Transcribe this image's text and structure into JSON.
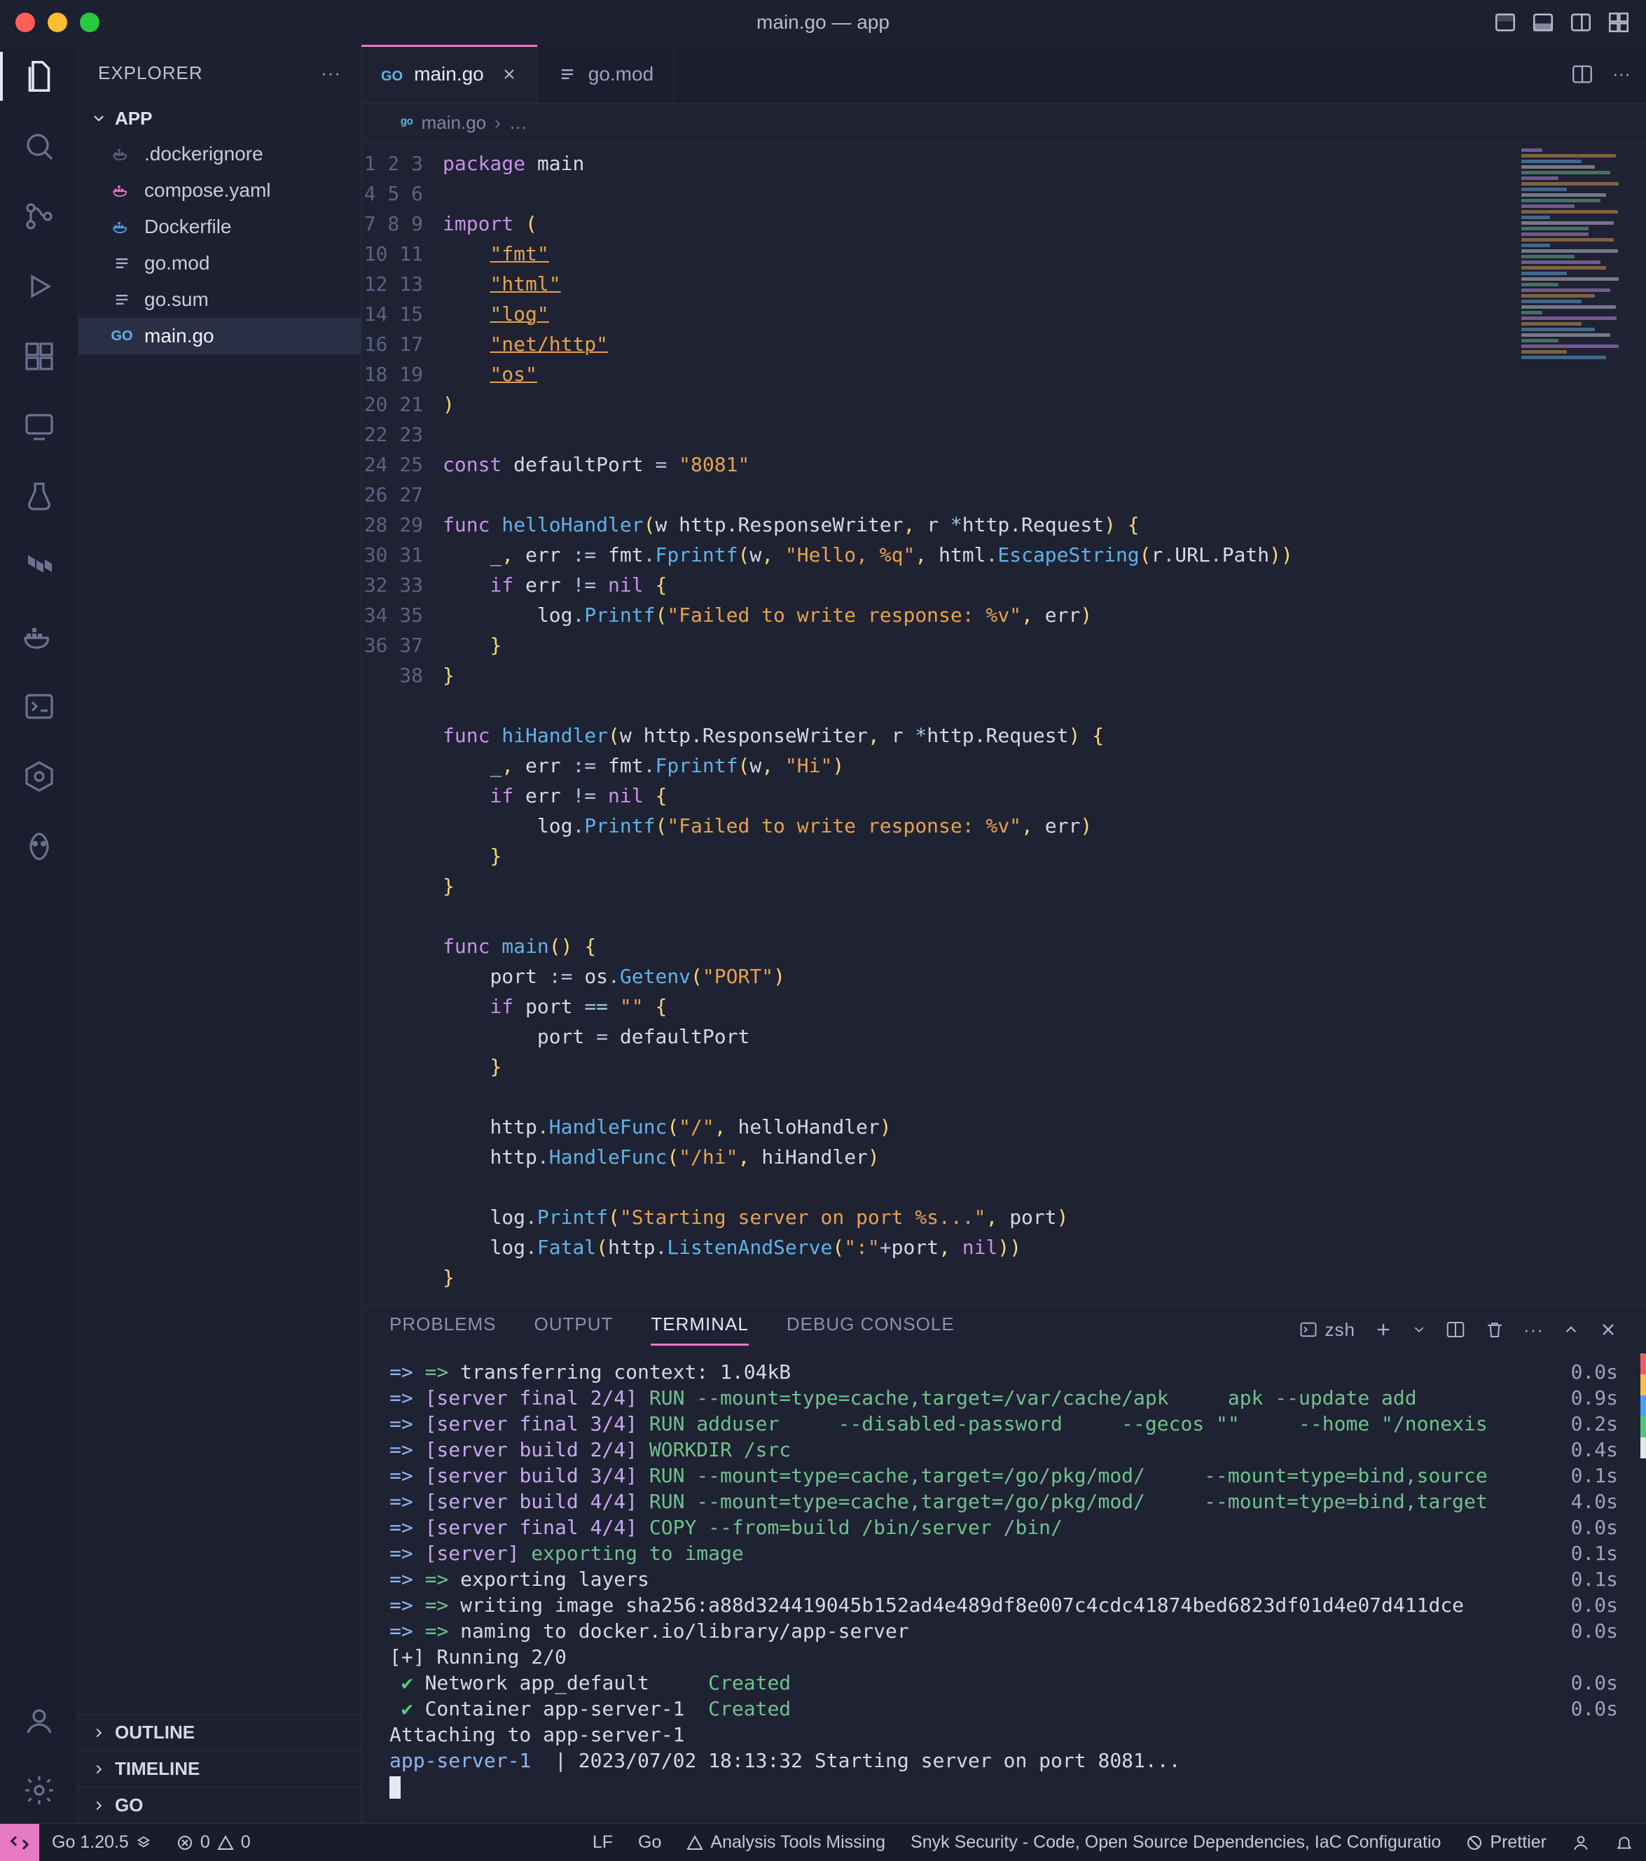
{
  "window": {
    "title": "main.go — app"
  },
  "explorer": {
    "title": "EXPLORER",
    "root": "APP",
    "files": [
      {
        "name": ".dockerignore",
        "icon": "docker-dim"
      },
      {
        "name": "compose.yaml",
        "icon": "docker-pink"
      },
      {
        "name": "Dockerfile",
        "icon": "docker"
      },
      {
        "name": "go.mod",
        "icon": "lines"
      },
      {
        "name": "go.sum",
        "icon": "lines"
      },
      {
        "name": "main.go",
        "icon": "go",
        "selected": true
      }
    ],
    "sections": [
      "OUTLINE",
      "TIMELINE",
      "GO"
    ]
  },
  "tabs": [
    {
      "label": "main.go",
      "icon": "go",
      "active": true,
      "closeable": true
    },
    {
      "label": "go.mod",
      "icon": "lines",
      "active": false,
      "closeable": false
    }
  ],
  "breadcrumb": {
    "file": "main.go",
    "trail": "…"
  },
  "code": {
    "lines": 38,
    "tokens": [
      [
        [
          "kw",
          "package"
        ],
        [
          "sp",
          " "
        ],
        [
          "id",
          "main"
        ]
      ],
      [],
      [
        [
          "kw",
          "import"
        ],
        [
          "sp",
          " "
        ],
        [
          "pun",
          "("
        ]
      ],
      [
        [
          "sp",
          "    "
        ],
        [
          "str-u",
          "\"fmt\""
        ]
      ],
      [
        [
          "sp",
          "    "
        ],
        [
          "str-u",
          "\"html\""
        ]
      ],
      [
        [
          "sp",
          "    "
        ],
        [
          "str-u",
          "\"log\""
        ]
      ],
      [
        [
          "sp",
          "    "
        ],
        [
          "str-u",
          "\"net/http\""
        ]
      ],
      [
        [
          "sp",
          "    "
        ],
        [
          "str-u",
          "\"os\""
        ]
      ],
      [
        [
          "pun",
          ")"
        ]
      ],
      [],
      [
        [
          "kw",
          "const"
        ],
        [
          "sp",
          " "
        ],
        [
          "id",
          "defaultPort"
        ],
        [
          "sp",
          " "
        ],
        [
          "op",
          "="
        ],
        [
          "sp",
          " "
        ],
        [
          "str",
          "\"8081\""
        ]
      ],
      [],
      [
        [
          "kw",
          "func"
        ],
        [
          "sp",
          " "
        ],
        [
          "name",
          "helloHandler"
        ],
        [
          "pun",
          "("
        ],
        [
          "id",
          "w"
        ],
        [
          "sp",
          " "
        ],
        [
          "typ",
          "http.ResponseWriter"
        ],
        [
          "pun",
          ","
        ],
        [
          "sp",
          " "
        ],
        [
          "id",
          "r"
        ],
        [
          "sp",
          " "
        ],
        [
          "op",
          "*"
        ],
        [
          "typ",
          "http.Request"
        ],
        [
          "pun",
          ")"
        ],
        [
          "sp",
          " "
        ],
        [
          "pun",
          "{"
        ]
      ],
      [
        [
          "sp",
          "    "
        ],
        [
          "id",
          "_"
        ],
        [
          "pun",
          ","
        ],
        [
          "sp",
          " "
        ],
        [
          "id",
          "err"
        ],
        [
          "sp",
          " "
        ],
        [
          "op",
          ":="
        ],
        [
          "sp",
          " "
        ],
        [
          "id",
          "fmt"
        ],
        [
          "op",
          "."
        ],
        [
          "call",
          "Fprintf"
        ],
        [
          "pun",
          "("
        ],
        [
          "id",
          "w"
        ],
        [
          "pun",
          ","
        ],
        [
          "sp",
          " "
        ],
        [
          "str",
          "\"Hello, %q\""
        ],
        [
          "pun",
          ","
        ],
        [
          "sp",
          " "
        ],
        [
          "id",
          "html"
        ],
        [
          "op",
          "."
        ],
        [
          "call",
          "EscapeString"
        ],
        [
          "pun",
          "("
        ],
        [
          "id",
          "r"
        ],
        [
          "op",
          "."
        ],
        [
          "id",
          "URL"
        ],
        [
          "op",
          "."
        ],
        [
          "id",
          "Path"
        ],
        [
          "pun",
          ")"
        ],
        [
          "pun",
          ")"
        ]
      ],
      [
        [
          "sp",
          "    "
        ],
        [
          "kw",
          "if"
        ],
        [
          "sp",
          " "
        ],
        [
          "id",
          "err"
        ],
        [
          "sp",
          " "
        ],
        [
          "op",
          "!="
        ],
        [
          "sp",
          " "
        ],
        [
          "bool",
          "nil"
        ],
        [
          "sp",
          " "
        ],
        [
          "pun",
          "{"
        ]
      ],
      [
        [
          "sp",
          "        "
        ],
        [
          "id",
          "log"
        ],
        [
          "op",
          "."
        ],
        [
          "call",
          "Printf"
        ],
        [
          "pun",
          "("
        ],
        [
          "str",
          "\"Failed to write response: %v\""
        ],
        [
          "pun",
          ","
        ],
        [
          "sp",
          " "
        ],
        [
          "id",
          "err"
        ],
        [
          "pun",
          ")"
        ]
      ],
      [
        [
          "sp",
          "    "
        ],
        [
          "pun",
          "}"
        ]
      ],
      [
        [
          "pun",
          "}"
        ]
      ],
      [],
      [
        [
          "kw",
          "func"
        ],
        [
          "sp",
          " "
        ],
        [
          "name",
          "hiHandler"
        ],
        [
          "pun",
          "("
        ],
        [
          "id",
          "w"
        ],
        [
          "sp",
          " "
        ],
        [
          "typ",
          "http.ResponseWriter"
        ],
        [
          "pun",
          ","
        ],
        [
          "sp",
          " "
        ],
        [
          "id",
          "r"
        ],
        [
          "sp",
          " "
        ],
        [
          "op",
          "*"
        ],
        [
          "typ",
          "http.Request"
        ],
        [
          "pun",
          ")"
        ],
        [
          "sp",
          " "
        ],
        [
          "pun",
          "{"
        ]
      ],
      [
        [
          "sp",
          "    "
        ],
        [
          "id",
          "_"
        ],
        [
          "pun",
          ","
        ],
        [
          "sp",
          " "
        ],
        [
          "id",
          "err"
        ],
        [
          "sp",
          " "
        ],
        [
          "op",
          ":="
        ],
        [
          "sp",
          " "
        ],
        [
          "id",
          "fmt"
        ],
        [
          "op",
          "."
        ],
        [
          "call",
          "Fprintf"
        ],
        [
          "pun",
          "("
        ],
        [
          "id",
          "w"
        ],
        [
          "pun",
          ","
        ],
        [
          "sp",
          " "
        ],
        [
          "str",
          "\"Hi\""
        ],
        [
          "pun",
          ")"
        ]
      ],
      [
        [
          "sp",
          "    "
        ],
        [
          "kw",
          "if"
        ],
        [
          "sp",
          " "
        ],
        [
          "id",
          "err"
        ],
        [
          "sp",
          " "
        ],
        [
          "op",
          "!="
        ],
        [
          "sp",
          " "
        ],
        [
          "bool",
          "nil"
        ],
        [
          "sp",
          " "
        ],
        [
          "pun",
          "{"
        ]
      ],
      [
        [
          "sp",
          "        "
        ],
        [
          "id",
          "log"
        ],
        [
          "op",
          "."
        ],
        [
          "call",
          "Printf"
        ],
        [
          "pun",
          "("
        ],
        [
          "str",
          "\"Failed to write response: %v\""
        ],
        [
          "pun",
          ","
        ],
        [
          "sp",
          " "
        ],
        [
          "id",
          "err"
        ],
        [
          "pun",
          ")"
        ]
      ],
      [
        [
          "sp",
          "    "
        ],
        [
          "pun",
          "}"
        ]
      ],
      [
        [
          "pun",
          "}"
        ]
      ],
      [],
      [
        [
          "kw",
          "func"
        ],
        [
          "sp",
          " "
        ],
        [
          "name",
          "main"
        ],
        [
          "pun",
          "("
        ],
        [
          "pun",
          ")"
        ],
        [
          "sp",
          " "
        ],
        [
          "pun",
          "{"
        ]
      ],
      [
        [
          "sp",
          "    "
        ],
        [
          "id",
          "port"
        ],
        [
          "sp",
          " "
        ],
        [
          "op",
          ":="
        ],
        [
          "sp",
          " "
        ],
        [
          "id",
          "os"
        ],
        [
          "op",
          "."
        ],
        [
          "call",
          "Getenv"
        ],
        [
          "pun",
          "("
        ],
        [
          "str",
          "\"PORT\""
        ],
        [
          "pun",
          ")"
        ]
      ],
      [
        [
          "sp",
          "    "
        ],
        [
          "kw",
          "if"
        ],
        [
          "sp",
          " "
        ],
        [
          "id",
          "port"
        ],
        [
          "sp",
          " "
        ],
        [
          "op",
          "=="
        ],
        [
          "sp",
          " "
        ],
        [
          "str",
          "\"\""
        ],
        [
          "sp",
          " "
        ],
        [
          "pun",
          "{"
        ]
      ],
      [
        [
          "sp",
          "        "
        ],
        [
          "id",
          "port"
        ],
        [
          "sp",
          " "
        ],
        [
          "op",
          "="
        ],
        [
          "sp",
          " "
        ],
        [
          "id",
          "defaultPort"
        ]
      ],
      [
        [
          "sp",
          "    "
        ],
        [
          "pun",
          "}"
        ]
      ],
      [],
      [
        [
          "sp",
          "    "
        ],
        [
          "id",
          "http"
        ],
        [
          "op",
          "."
        ],
        [
          "call",
          "HandleFunc"
        ],
        [
          "pun",
          "("
        ],
        [
          "str",
          "\"/\""
        ],
        [
          "pun",
          ","
        ],
        [
          "sp",
          " "
        ],
        [
          "id",
          "helloHandler"
        ],
        [
          "pun",
          ")"
        ]
      ],
      [
        [
          "sp",
          "    "
        ],
        [
          "id",
          "http"
        ],
        [
          "op",
          "."
        ],
        [
          "call",
          "HandleFunc"
        ],
        [
          "pun",
          "("
        ],
        [
          "str",
          "\"/hi\""
        ],
        [
          "pun",
          ","
        ],
        [
          "sp",
          " "
        ],
        [
          "id",
          "hiHandler"
        ],
        [
          "pun",
          ")"
        ]
      ],
      [],
      [
        [
          "sp",
          "    "
        ],
        [
          "id",
          "log"
        ],
        [
          "op",
          "."
        ],
        [
          "call",
          "Printf"
        ],
        [
          "pun",
          "("
        ],
        [
          "str",
          "\"Starting server on port %s...\""
        ],
        [
          "pun",
          ","
        ],
        [
          "sp",
          " "
        ],
        [
          "id",
          "port"
        ],
        [
          "pun",
          ")"
        ]
      ],
      [
        [
          "sp",
          "    "
        ],
        [
          "id",
          "log"
        ],
        [
          "op",
          "."
        ],
        [
          "call",
          "Fatal"
        ],
        [
          "pun",
          "("
        ],
        [
          "id",
          "http"
        ],
        [
          "op",
          "."
        ],
        [
          "call",
          "ListenAndServe"
        ],
        [
          "pun",
          "("
        ],
        [
          "str",
          "\":\""
        ],
        [
          "op",
          "+"
        ],
        [
          "id",
          "port"
        ],
        [
          "pun",
          ","
        ],
        [
          "sp",
          " "
        ],
        [
          "bool",
          "nil"
        ],
        [
          "pun",
          ")"
        ],
        [
          "pun",
          ")"
        ]
      ],
      [
        [
          "pun",
          "}"
        ]
      ]
    ]
  },
  "panel": {
    "tabs": [
      "PROBLEMS",
      "OUTPUT",
      "TERMINAL",
      "DEBUG CONSOLE"
    ],
    "active": "TERMINAL",
    "shell": "zsh",
    "lines": [
      {
        "l": [
          [
            "arrow",
            "=> "
          ],
          [
            "green2",
            "=> "
          ],
          [
            "y",
            "transferring context: 1.04kB"
          ]
        ],
        "r": "0.0s"
      },
      {
        "l": [
          [
            "arrow",
            "=> "
          ],
          [
            "brk",
            "[server final 2/4] "
          ],
          [
            "step",
            "RUN --mount=type=cache,target=/var/cache/apk     apk --update add"
          ]
        ],
        "r": "0.9s"
      },
      {
        "l": [
          [
            "arrow",
            "=> "
          ],
          [
            "brk",
            "[server final 3/4] "
          ],
          [
            "step",
            "RUN adduser     --disabled-password     --gecos \"\"     --home \"/nonexis"
          ]
        ],
        "r": "0.2s"
      },
      {
        "l": [
          [
            "arrow",
            "=> "
          ],
          [
            "brk",
            "[server build 2/4] "
          ],
          [
            "step",
            "WORKDIR /src"
          ]
        ],
        "r": "0.4s"
      },
      {
        "l": [
          [
            "arrow",
            "=> "
          ],
          [
            "brk",
            "[server build 3/4] "
          ],
          [
            "step",
            "RUN --mount=type=cache,target=/go/pkg/mod/     --mount=type=bind,source"
          ]
        ],
        "r": "0.1s"
      },
      {
        "l": [
          [
            "arrow",
            "=> "
          ],
          [
            "brk",
            "[server build 4/4] "
          ],
          [
            "step",
            "RUN --mount=type=cache,target=/go/pkg/mod/     --mount=type=bind,target"
          ]
        ],
        "r": "4.0s"
      },
      {
        "l": [
          [
            "arrow",
            "=> "
          ],
          [
            "brk",
            "[server final 4/4] "
          ],
          [
            "step",
            "COPY --from=build /bin/server /bin/"
          ]
        ],
        "r": "0.0s"
      },
      {
        "l": [
          [
            "arrow",
            "=> "
          ],
          [
            "brk",
            "[server] "
          ],
          [
            "step",
            "exporting to image"
          ]
        ],
        "r": "0.1s"
      },
      {
        "l": [
          [
            "arrow",
            "=> "
          ],
          [
            "green2",
            "=> "
          ],
          [
            "y",
            "exporting layers"
          ]
        ],
        "r": "0.1s"
      },
      {
        "l": [
          [
            "arrow",
            "=> "
          ],
          [
            "green2",
            "=> "
          ],
          [
            "y",
            "writing image sha256:a88d324419045b152ad4e489df8e007c4cdc41874bed6823df01d4e07d411dce"
          ]
        ],
        "r": "0.0s"
      },
      {
        "l": [
          [
            "arrow",
            "=> "
          ],
          [
            "green2",
            "=> "
          ],
          [
            "y",
            "naming to docker.io/library/app-server"
          ]
        ],
        "r": "0.0s"
      },
      {
        "l": [
          [
            "y",
            "[+]"
          ],
          [
            "y",
            " Running 2/0"
          ]
        ],
        "r": ""
      },
      {
        "l": [
          [
            "check",
            " ✔ "
          ],
          [
            "y",
            "Network app_default     "
          ],
          [
            "created",
            "Created"
          ]
        ],
        "r": "0.0s"
      },
      {
        "l": [
          [
            "check",
            " ✔ "
          ],
          [
            "y",
            "Container app-server-1  "
          ],
          [
            "created",
            "Created"
          ]
        ],
        "r": "0.0s"
      },
      {
        "l": [
          [
            "attach",
            "Attaching to app-server-1"
          ]
        ],
        "r": ""
      },
      {
        "l": [
          [
            "app",
            "app-server-1  "
          ],
          [
            "y",
            "|"
          ],
          [
            "y",
            " 2023/07/02 18:13:32 Starting server on port 8081..."
          ]
        ],
        "r": ""
      }
    ]
  },
  "status": {
    "go": "Go 1.20.5",
    "errors": "0",
    "warnings": "0",
    "lf": "LF",
    "lang": "Go",
    "analysis": "Analysis Tools Missing",
    "snyk": "Snyk Security - Code, Open Source Dependencies, IaC Configuratio",
    "prettier": "Prettier"
  }
}
